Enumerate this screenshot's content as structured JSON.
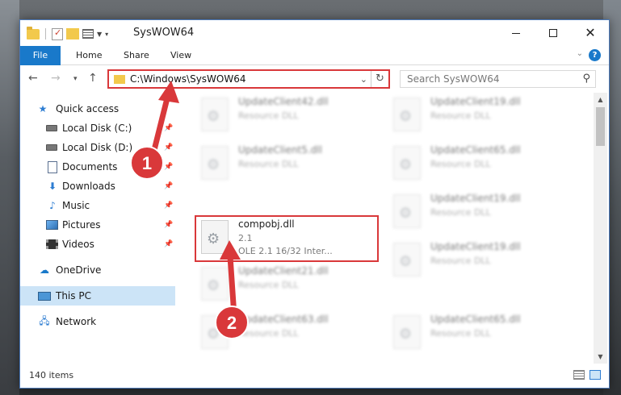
{
  "window": {
    "title": "SysWOW64"
  },
  "ribbon": {
    "tabs": [
      "File",
      "Home",
      "Share",
      "View"
    ],
    "help": "?"
  },
  "address": {
    "path": "C:\\Windows\\SysWOW64"
  },
  "search": {
    "placeholder": "Search SysWOW64"
  },
  "sidebar": {
    "items": [
      {
        "label": "Quick access"
      },
      {
        "label": "Local Disk (C:)"
      },
      {
        "label": "Local Disk (D:)"
      },
      {
        "label": "Documents"
      },
      {
        "label": "Downloads"
      },
      {
        "label": "Music"
      },
      {
        "label": "Pictures"
      },
      {
        "label": "Videos"
      },
      {
        "label": "OneDrive"
      },
      {
        "label": "This PC"
      },
      {
        "label": "Network"
      }
    ]
  },
  "files": {
    "left": [
      {
        "name": "UpdateClient42.dll",
        "type": "Resource DLL"
      },
      {
        "name": "UpdateClient5.dll",
        "type": "Resource DLL"
      },
      {
        "name": "compobj.dll",
        "version": "2.1",
        "desc": "OLE 2.1 16/32 Inter..."
      },
      {
        "name": "UpdateClient21.dll",
        "type": "Resource DLL"
      },
      {
        "name": "UpdateClient63.dll",
        "type": "Resource DLL"
      }
    ],
    "right": [
      {
        "name": "UpdateClient19.dll",
        "type": "Resource DLL"
      },
      {
        "name": "UpdateClient65.dll",
        "type": "Resource DLL"
      },
      {
        "name": "UpdateClient19.dll",
        "type": "Resource DLL"
      },
      {
        "name": "UpdateClient19.dll",
        "type": "Resource DLL"
      },
      {
        "name": "UpdateClient65.dll",
        "type": "Resource DLL"
      }
    ]
  },
  "status": {
    "count": "140 items"
  },
  "annotations": {
    "step1": "1",
    "step2": "2",
    "color": "#d9383a"
  }
}
